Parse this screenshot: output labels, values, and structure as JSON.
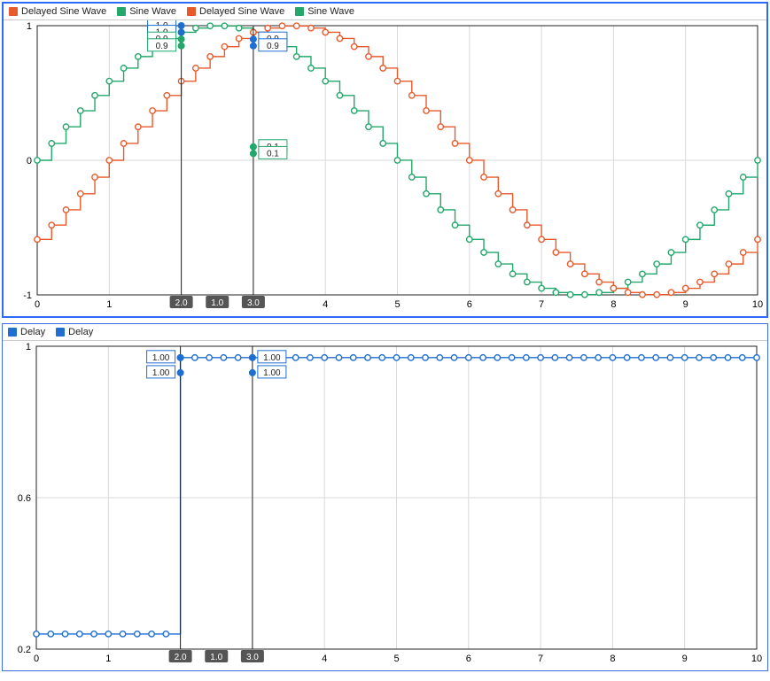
{
  "panels": [
    {
      "id": "sine",
      "selected": true,
      "legend": [
        {
          "label": "Delayed Sine Wave",
          "color": "#e85a2c"
        },
        {
          "label": "Sine Wave",
          "color": "#23a76b"
        },
        {
          "label": "Delayed Sine Wave",
          "color": "#e85a2c"
        },
        {
          "label": "Sine Wave",
          "color": "#23a76b"
        }
      ],
      "xlim": [
        0,
        10
      ],
      "ylim": [
        -1,
        1
      ],
      "xticks": [
        0,
        1,
        2,
        3,
        4,
        5,
        6,
        7,
        8,
        9,
        10
      ],
      "yticks": [
        -1,
        0,
        1
      ],
      "cursors": [
        {
          "x": 2.0,
          "label": "2.0",
          "readouts": [
            {
              "series": "delayed",
              "y": 1.0,
              "text": "1.0"
            },
            {
              "series": "delayed2",
              "y": 0.95,
              "text": "1.0"
            },
            {
              "series": "sine",
              "y": 0.9,
              "text": "0.9"
            },
            {
              "series": "sine2",
              "y": 0.85,
              "text": "0.9"
            }
          ],
          "midlabel": "1.0"
        },
        {
          "x": 3.0,
          "label": "3.0",
          "readouts": [
            {
              "series": "delayed",
              "y": 0.9,
              "text": "0.9"
            },
            {
              "series": "delayed2",
              "y": 0.85,
              "text": "0.9"
            },
            {
              "series": "sine",
              "y": 0.1,
              "text": "0.1"
            },
            {
              "series": "sine2",
              "y": 0.05,
              "text": "0.1"
            }
          ]
        }
      ]
    },
    {
      "id": "delay",
      "selected": false,
      "legend": [
        {
          "label": "Delay",
          "color": "#1f6fd1"
        },
        {
          "label": "Delay",
          "color": "#1f6fd1"
        }
      ],
      "xlim": [
        0,
        10
      ],
      "ylim": [
        0.2,
        1.0
      ],
      "xticks": [
        0,
        1,
        2,
        3,
        4,
        5,
        6,
        7,
        8,
        9,
        10
      ],
      "yticks": [
        0.2,
        0.6,
        1.0
      ],
      "cursors": [
        {
          "x": 2.0,
          "label": "2.0",
          "readouts": [
            {
              "series": "delay",
              "y": 0.97,
              "text": "1.00"
            },
            {
              "series": "delay2",
              "y": 0.93,
              "text": "1.00"
            }
          ],
          "midlabel": "1.0"
        },
        {
          "x": 3.0,
          "label": "3.0",
          "readouts": [
            {
              "series": "delay",
              "y": 0.97,
              "text": "1.00"
            },
            {
              "series": "delay2",
              "y": 0.93,
              "text": "1.00"
            }
          ]
        }
      ]
    }
  ],
  "chart_data": [
    {
      "type": "line",
      "title": "",
      "xlabel": "",
      "ylabel": "",
      "xlim": [
        0,
        10
      ],
      "ylim": [
        -1,
        1
      ],
      "step": "post",
      "series": [
        {
          "name": "Sine Wave",
          "color": "#23a76b",
          "dt": 0.2,
          "phase": 0.0,
          "amp": 1.0,
          "freq": 0.628
        },
        {
          "name": "Delayed Sine Wave",
          "color": "#e85a2c",
          "dt": 0.2,
          "phase": 1.0,
          "amp": 1.0,
          "freq": 0.628
        }
      ],
      "cursors": [
        {
          "x": 2.0,
          "values": {
            "Delayed Sine Wave": 1.0,
            "Sine Wave": 0.9
          }
        },
        {
          "x": 3.0,
          "values": {
            "Delayed Sine Wave": 0.9,
            "Sine Wave": 0.1
          }
        }
      ],
      "legend_position": "top"
    },
    {
      "type": "line",
      "title": "",
      "xlabel": "",
      "ylabel": "",
      "xlim": [
        0,
        10
      ],
      "ylim": [
        0.2,
        1.0
      ],
      "step": "post",
      "series": [
        {
          "name": "Delay",
          "color": "#1f6fd1",
          "dt": 0.2,
          "x": [
            0,
            2,
            10
          ],
          "y": [
            0.24,
            0.97,
            0.97
          ]
        }
      ],
      "cursors": [
        {
          "x": 2.0,
          "values": {
            "Delay": 1.0
          }
        },
        {
          "x": 3.0,
          "values": {
            "Delay": 1.0
          }
        }
      ],
      "legend_position": "top"
    }
  ]
}
